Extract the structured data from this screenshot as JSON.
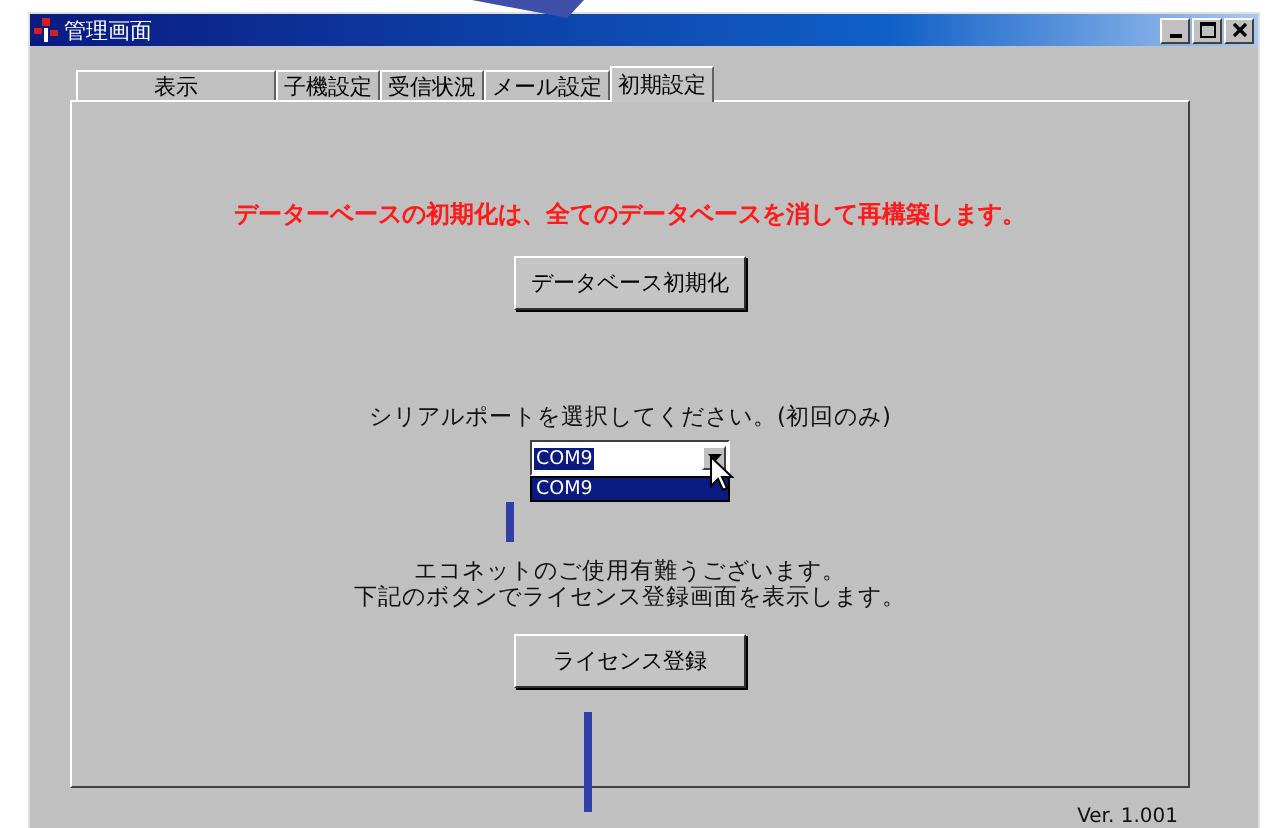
{
  "window": {
    "title": "管理画面"
  },
  "tabs": [
    {
      "label": "表示",
      "selected": false
    },
    {
      "label": "子機設定",
      "selected": false
    },
    {
      "label": "受信状況",
      "selected": false
    },
    {
      "label": "メール設定",
      "selected": false
    },
    {
      "label": "初期設定",
      "selected": true
    }
  ],
  "warning": "データーベースの初期化は、全てのデータベースを消して再構築します。",
  "init_button": "データベース初期化",
  "serial_prompt": "シリアルポートを選択してください。(初回のみ)",
  "port_select": {
    "value": "COM9",
    "expanded": true,
    "options": [
      {
        "label": "COM9",
        "selected": true
      }
    ]
  },
  "license_message": [
    "エコネットのご使用有難うございます。",
    "下記のボタンでライセンス登録画面を表示します。"
  ],
  "license_button": "ライセンス登録",
  "version": "Ver. 1.001"
}
